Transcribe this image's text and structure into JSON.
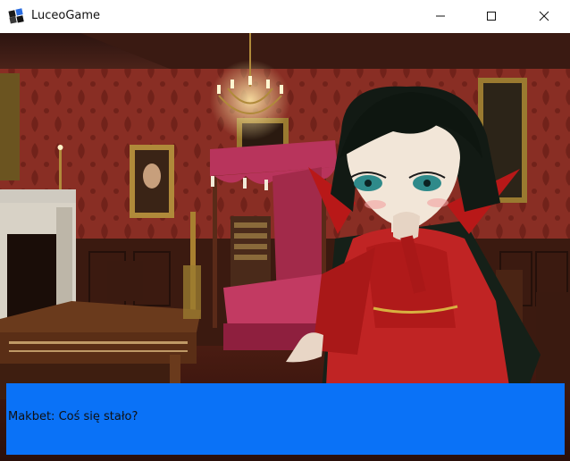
{
  "window": {
    "title": "LuceoGame",
    "icon": "luceo-app-icon",
    "controls": [
      "minimize-icon",
      "maximize-icon",
      "close-icon"
    ]
  },
  "scene": {
    "background": "castle-bedroom-background",
    "character_sprite": "makbet-character-sprite"
  },
  "dialog": {
    "text": "Makbet: Coś się stało?",
    "background_color": "#0a72f7"
  }
}
